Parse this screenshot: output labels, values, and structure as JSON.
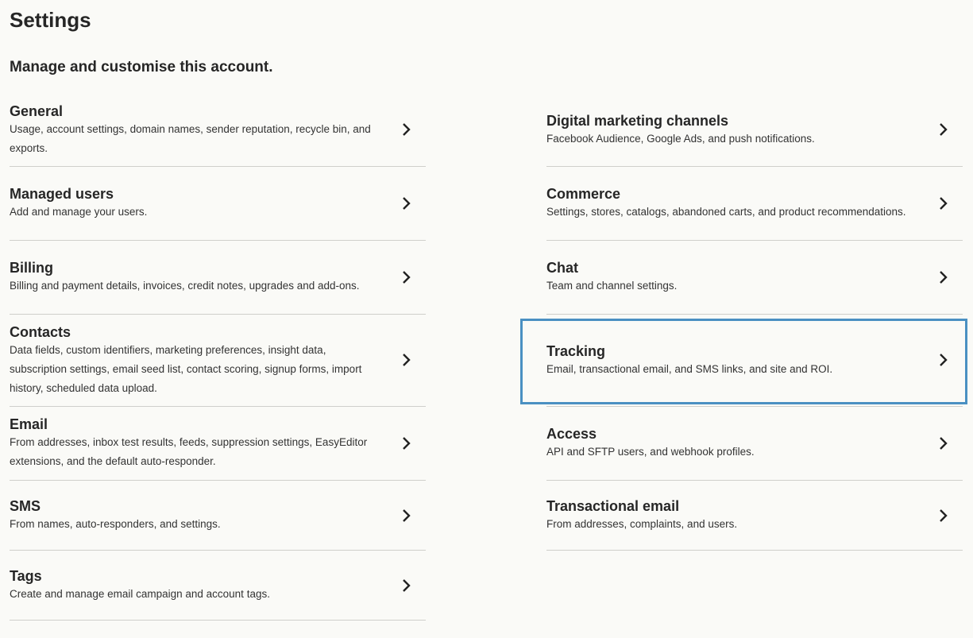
{
  "header": {
    "title": "Settings",
    "subtitle": "Manage and customise this account."
  },
  "left": [
    {
      "title": "General",
      "desc": "Usage, account settings, domain names, sender reputation, recycle bin, and exports."
    },
    {
      "title": "Managed users",
      "desc": "Add and manage your users."
    },
    {
      "title": "Billing",
      "desc": "Billing and payment details, invoices, credit notes, upgrades and add-ons."
    },
    {
      "title": "Contacts",
      "desc": "Data fields, custom identifiers, marketing preferences, insight data, subscription settings, email seed list, contact scoring, signup forms, import history, scheduled data upload."
    },
    {
      "title": "Email",
      "desc": "From addresses, inbox test results, feeds, suppression settings, EasyEditor extensions, and the default auto-responder."
    },
    {
      "title": "SMS",
      "desc": "From names, auto-responders, and settings."
    },
    {
      "title": "Tags",
      "desc": "Create and manage email campaign and account tags."
    }
  ],
  "right": [
    {
      "title": "Digital marketing channels",
      "desc": "Facebook Audience, Google Ads, and push notifications."
    },
    {
      "title": "Commerce",
      "desc": "Settings, stores, catalogs, abandoned carts, and product recommendations."
    },
    {
      "title": "Chat",
      "desc": "Team and channel settings."
    },
    {
      "title": "Tracking",
      "desc": "Email, transactional email, and SMS links, and site and ROI."
    },
    {
      "title": "Access",
      "desc": "API and SFTP users, and webhook profiles."
    },
    {
      "title": "Transactional email",
      "desc": "From addresses, complaints, and users."
    }
  ],
  "highlight_color": "#4a90c2",
  "chevron_icon": "chevron-right-icon"
}
